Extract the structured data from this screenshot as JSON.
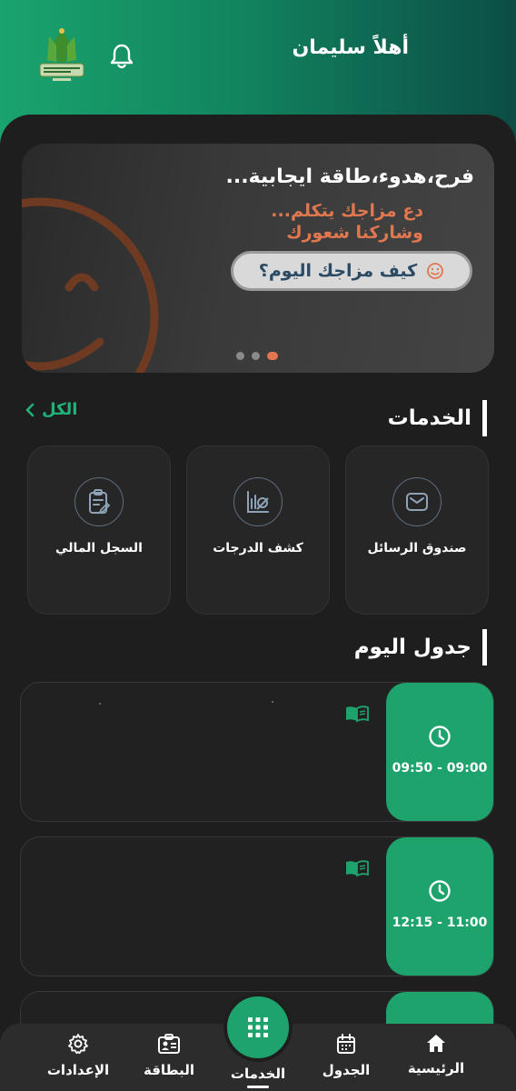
{
  "header": {
    "greeting": "أهلاً سليمان"
  },
  "banner": {
    "title": "فرح،هدوء،طاقة ايجابية...",
    "subtitle_line1": "دع مزاجك يتكلم...",
    "subtitle_line2": "وشاركنا شعورك",
    "mood_button_label": "كيف مزاجك اليوم؟",
    "pagination": {
      "total": 3,
      "active": 3
    },
    "accent_color": "#e0774e"
  },
  "services": {
    "title": "الخدمات",
    "see_all_label": "الكل",
    "items": [
      {
        "label": "صندوق الرسائل",
        "icon": "message-box-icon"
      },
      {
        "label": "كشف الدرجات",
        "icon": "grades-report-icon"
      },
      {
        "label": "السجل المالي",
        "icon": "financial-record-icon"
      }
    ]
  },
  "schedule": {
    "title": "جدول اليوم",
    "classes": [
      {
        "time": "09:50 - 09:00",
        "icon": "book-icon"
      },
      {
        "time": "12:15 - 11:00",
        "icon": "book-icon"
      }
    ]
  },
  "nav": {
    "items": [
      {
        "label": "الرئيسية",
        "icon": "home-icon"
      },
      {
        "label": "الجدول",
        "icon": "calendar-icon"
      },
      {
        "label": "الخدمات",
        "icon": "grid-icon"
      },
      {
        "label": "البطاقة",
        "icon": "id-card-icon"
      },
      {
        "label": "الإعدادات",
        "icon": "gear-icon"
      }
    ]
  },
  "colors": {
    "primary_green": "#1fa36d",
    "background": "#1e1e1e"
  }
}
